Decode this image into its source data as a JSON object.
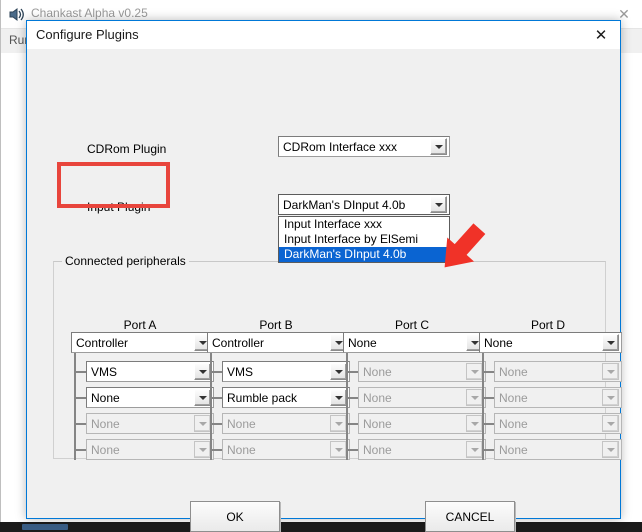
{
  "background_window": {
    "title": "Chankast Alpha v0.25",
    "app_icon": "speaker-icon",
    "close_label": "✕",
    "menu": [
      {
        "label": "Run"
      }
    ]
  },
  "dialog": {
    "title": "Configure Plugins",
    "close_label": "✕",
    "cdrom": {
      "label": "CDRom Plugin",
      "selected": "CDRom Interface xxx"
    },
    "input": {
      "label": "Input Plugin",
      "selected": "DarkMan's DInput 4.0b",
      "expanded": true,
      "options": [
        {
          "label": "Input Interface xxx",
          "selected": false
        },
        {
          "label": "Input Interface by ElSemi",
          "selected": false
        },
        {
          "label": "DarkMan's DInput 4.0b",
          "selected": true
        }
      ]
    },
    "peripherals": {
      "legend": "Connected peripherals",
      "ports": [
        {
          "name": "Port A",
          "device": {
            "value": "Controller",
            "enabled": true
          },
          "slots": [
            {
              "value": "VMS",
              "enabled": true
            },
            {
              "value": "None",
              "enabled": true
            },
            {
              "value": "None",
              "enabled": false
            },
            {
              "value": "None",
              "enabled": false
            }
          ]
        },
        {
          "name": "Port B",
          "device": {
            "value": "Controller",
            "enabled": true
          },
          "slots": [
            {
              "value": "VMS",
              "enabled": true
            },
            {
              "value": "Rumble pack",
              "enabled": true
            },
            {
              "value": "None",
              "enabled": false
            },
            {
              "value": "None",
              "enabled": false
            }
          ]
        },
        {
          "name": "Port C",
          "device": {
            "value": "None",
            "enabled": true
          },
          "slots": [
            {
              "value": "None",
              "enabled": false
            },
            {
              "value": "None",
              "enabled": false
            },
            {
              "value": "None",
              "enabled": false
            },
            {
              "value": "None",
              "enabled": false
            }
          ]
        },
        {
          "name": "Port D",
          "device": {
            "value": "None",
            "enabled": true
          },
          "slots": [
            {
              "value": "None",
              "enabled": false
            },
            {
              "value": "None",
              "enabled": false
            },
            {
              "value": "None",
              "enabled": false
            },
            {
              "value": "None",
              "enabled": false
            }
          ]
        }
      ]
    },
    "buttons": {
      "ok": "OK",
      "cancel": "CANCEL"
    }
  },
  "annotations": {
    "highlight_color": "#e8453c",
    "arrow_color": "#f03228",
    "highlight_target": "Input Plugin",
    "arrow_target": "DarkMan's DInput 4.0b"
  }
}
